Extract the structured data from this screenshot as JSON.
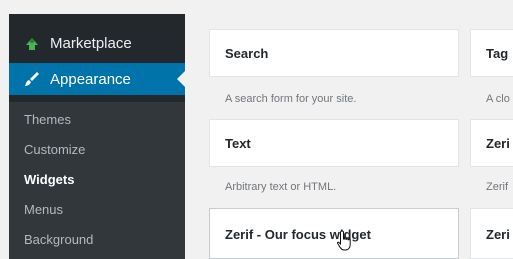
{
  "sidebar": {
    "marketplace_label": "Marketplace",
    "appearance_label": "Appearance",
    "submenu": [
      "Themes",
      "Customize",
      "Widgets",
      "Menus",
      "Background"
    ],
    "current_item": "Widgets"
  },
  "widgets": {
    "col1": [
      {
        "title": "Search",
        "description": "A search form for your site."
      },
      {
        "title": "Text",
        "description": "Arbitrary text or HTML."
      },
      {
        "title": "Zerif - Our focus widget",
        "description": ""
      }
    ],
    "col2": [
      {
        "title": "Tag",
        "description": "A clo"
      },
      {
        "title": "Zeri",
        "description": "Zerif"
      },
      {
        "title": "Zeri",
        "description": ""
      }
    ]
  },
  "colors": {
    "sidebar_bg": "#23282d",
    "submenu_bg": "#32373c",
    "accent": "#0073aa",
    "marketplace_icon": "#46b450"
  },
  "icons": {
    "marketplace": "marketplace-icon",
    "appearance": "paintbrush-icon",
    "cursor": "hand-pointer-icon"
  }
}
